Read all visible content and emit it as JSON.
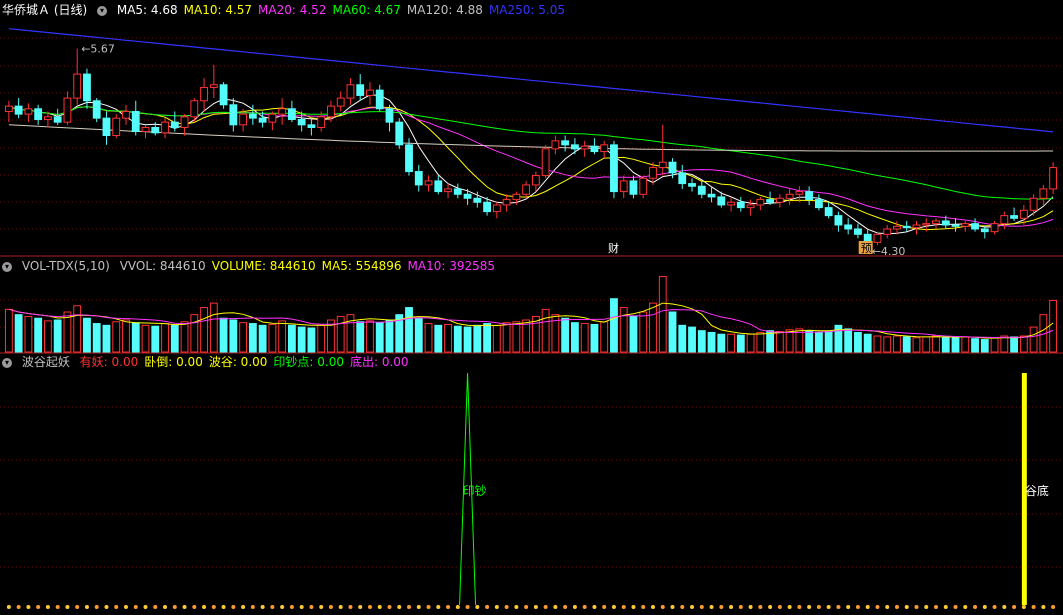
{
  "main": {
    "title": "华侨城Ａ (日线)",
    "ma": [
      {
        "label": "MA5: 4.68",
        "color": "#ffffff"
      },
      {
        "label": "MA10: 4.57",
        "color": "#ffff00"
      },
      {
        "label": "MA20: 4.52",
        "color": "#ff33ff"
      },
      {
        "label": "MA60: 4.67",
        "color": "#00ff00"
      },
      {
        "label": "MA120: 4.88",
        "color": "#c0c0c0"
      },
      {
        "label": "MA250: 5.05",
        "color": "#3333ff"
      }
    ],
    "high_label": "5.67",
    "low_label": "4.30",
    "event_caicai": "财",
    "event_yu": "预"
  },
  "volume": {
    "title": "VOL-TDX(5,10)",
    "items": [
      {
        "label": "VVOL: 844610",
        "color": "#c0c0c0"
      },
      {
        "label": "VOLUME: 844610",
        "color": "#ffff00"
      },
      {
        "label": "MA5: 554896",
        "color": "#ffff00"
      },
      {
        "label": "MA10: 392585",
        "color": "#ff33ff"
      }
    ]
  },
  "indicator": {
    "title": "波谷起妖",
    "items": [
      {
        "label": "有妖: 0.00",
        "color": "#ff3333"
      },
      {
        "label": "卧倒: 0.00",
        "color": "#ffff00"
      },
      {
        "label": "波谷: 0.00",
        "color": "#ffff00"
      },
      {
        "label": "印钞点: 0.00",
        "color": "#00ff00"
      },
      {
        "label": "底出: 0.00",
        "color": "#ff33ff"
      }
    ],
    "spike_label": "印钞",
    "bar_label": "谷底"
  },
  "chart_data": {
    "type": "candlestick",
    "up_color": "#ff3232",
    "down_color": "#54fcfc",
    "price_range": [
      4.2,
      5.9
    ],
    "ohlc": [
      [
        5.2,
        5.28,
        5.12,
        5.24
      ],
      [
        5.24,
        5.3,
        5.15,
        5.18
      ],
      [
        5.18,
        5.26,
        5.12,
        5.22
      ],
      [
        5.22,
        5.25,
        5.1,
        5.14
      ],
      [
        5.14,
        5.2,
        5.08,
        5.16
      ],
      [
        5.16,
        5.22,
        5.1,
        5.12
      ],
      [
        5.12,
        5.35,
        5.1,
        5.3
      ],
      [
        5.3,
        5.67,
        5.25,
        5.48
      ],
      [
        5.48,
        5.52,
        5.22,
        5.28
      ],
      [
        5.28,
        5.3,
        5.12,
        5.15
      ],
      [
        5.15,
        5.2,
        4.95,
        5.02
      ],
      [
        5.02,
        5.18,
        5.0,
        5.15
      ],
      [
        5.15,
        5.25,
        5.1,
        5.2
      ],
      [
        5.2,
        5.28,
        5.02,
        5.05
      ],
      [
        5.05,
        5.1,
        5.0,
        5.08
      ],
      [
        5.08,
        5.12,
        5.02,
        5.04
      ],
      [
        5.04,
        5.15,
        5.0,
        5.12
      ],
      [
        5.12,
        5.2,
        5.05,
        5.08
      ],
      [
        5.08,
        5.18,
        5.02,
        5.16
      ],
      [
        5.16,
        5.3,
        5.12,
        5.28
      ],
      [
        5.28,
        5.45,
        5.2,
        5.38
      ],
      [
        5.38,
        5.55,
        5.3,
        5.4
      ],
      [
        5.4,
        5.42,
        5.22,
        5.25
      ],
      [
        5.25,
        5.3,
        5.05,
        5.1
      ],
      [
        5.1,
        5.22,
        5.05,
        5.18
      ],
      [
        5.18,
        5.25,
        5.1,
        5.15
      ],
      [
        5.15,
        5.2,
        5.08,
        5.12
      ],
      [
        5.12,
        5.2,
        5.06,
        5.18
      ],
      [
        5.18,
        5.3,
        5.1,
        5.22
      ],
      [
        5.22,
        5.28,
        5.12,
        5.14
      ],
      [
        5.14,
        5.2,
        5.05,
        5.1
      ],
      [
        5.1,
        5.15,
        5.02,
        5.08
      ],
      [
        5.08,
        5.2,
        5.05,
        5.16
      ],
      [
        5.16,
        5.28,
        5.12,
        5.24
      ],
      [
        5.24,
        5.35,
        5.2,
        5.3
      ],
      [
        5.3,
        5.45,
        5.25,
        5.4
      ],
      [
        5.4,
        5.48,
        5.28,
        5.32
      ],
      [
        5.32,
        5.42,
        5.25,
        5.36
      ],
      [
        5.36,
        5.4,
        5.2,
        5.22
      ],
      [
        5.22,
        5.25,
        5.05,
        5.12
      ],
      [
        5.12,
        5.15,
        4.92,
        4.95
      ],
      [
        4.95,
        5.0,
        4.72,
        4.75
      ],
      [
        4.75,
        4.8,
        4.6,
        4.65
      ],
      [
        4.65,
        4.72,
        4.6,
        4.68
      ],
      [
        4.68,
        4.72,
        4.58,
        4.6
      ],
      [
        4.6,
        4.66,
        4.55,
        4.62
      ],
      [
        4.62,
        4.66,
        4.55,
        4.58
      ],
      [
        4.58,
        4.62,
        4.5,
        4.55
      ],
      [
        4.55,
        4.6,
        4.48,
        4.52
      ],
      [
        4.52,
        4.56,
        4.42,
        4.45
      ],
      [
        4.45,
        4.52,
        4.4,
        4.5
      ],
      [
        4.5,
        4.58,
        4.45,
        4.54
      ],
      [
        4.54,
        4.6,
        4.5,
        4.58
      ],
      [
        4.58,
        4.68,
        4.55,
        4.65
      ],
      [
        4.65,
        4.75,
        4.6,
        4.72
      ],
      [
        4.72,
        4.95,
        4.7,
        4.92
      ],
      [
        4.92,
        5.02,
        4.88,
        4.98
      ],
      [
        4.98,
        5.02,
        4.9,
        4.95
      ],
      [
        4.95,
        5.0,
        4.88,
        4.92
      ],
      [
        4.92,
        4.98,
        4.86,
        4.94
      ],
      [
        4.94,
        5.0,
        4.88,
        4.9
      ],
      [
        4.9,
        4.98,
        4.85,
        4.95
      ],
      [
        4.95,
        4.98,
        4.55,
        4.6
      ],
      [
        4.6,
        4.72,
        4.55,
        4.68
      ],
      [
        4.68,
        4.72,
        4.55,
        4.58
      ],
      [
        4.58,
        4.72,
        4.55,
        4.7
      ],
      [
        4.7,
        4.82,
        4.65,
        4.78
      ],
      [
        4.78,
        5.1,
        4.72,
        4.82
      ],
      [
        4.82,
        4.85,
        4.7,
        4.74
      ],
      [
        4.74,
        4.8,
        4.62,
        4.66
      ],
      [
        4.66,
        4.7,
        4.6,
        4.64
      ],
      [
        4.64,
        4.68,
        4.55,
        4.58
      ],
      [
        4.58,
        4.64,
        4.52,
        4.56
      ],
      [
        4.56,
        4.6,
        4.48,
        4.5
      ],
      [
        4.5,
        4.56,
        4.45,
        4.52
      ],
      [
        4.52,
        4.56,
        4.45,
        4.48
      ],
      [
        4.48,
        4.54,
        4.42,
        4.5
      ],
      [
        4.5,
        4.56,
        4.46,
        4.54
      ],
      [
        4.54,
        4.6,
        4.5,
        4.52
      ],
      [
        4.52,
        4.58,
        4.48,
        4.55
      ],
      [
        4.55,
        4.62,
        4.5,
        4.58
      ],
      [
        4.58,
        4.64,
        4.52,
        4.6
      ],
      [
        4.6,
        4.64,
        4.5,
        4.54
      ],
      [
        4.54,
        4.58,
        4.46,
        4.48
      ],
      [
        4.48,
        4.52,
        4.4,
        4.42
      ],
      [
        4.42,
        4.45,
        4.3,
        4.35
      ],
      [
        4.35,
        4.4,
        4.28,
        4.32
      ],
      [
        4.32,
        4.36,
        4.25,
        4.28
      ],
      [
        4.28,
        4.32,
        4.2,
        4.22
      ],
      [
        4.22,
        4.3,
        4.2,
        4.28
      ],
      [
        4.28,
        4.35,
        4.25,
        4.32
      ],
      [
        4.32,
        4.38,
        4.28,
        4.34
      ],
      [
        4.34,
        4.38,
        4.3,
        4.33
      ],
      [
        4.33,
        4.38,
        4.28,
        4.35
      ],
      [
        4.35,
        4.4,
        4.3,
        4.36
      ],
      [
        4.36,
        4.4,
        4.32,
        4.38
      ],
      [
        4.38,
        4.42,
        4.32,
        4.35
      ],
      [
        4.35,
        4.4,
        4.3,
        4.34
      ],
      [
        4.34,
        4.38,
        4.3,
        4.36
      ],
      [
        4.36,
        4.4,
        4.3,
        4.32
      ],
      [
        4.32,
        4.34,
        4.25,
        4.3
      ],
      [
        4.3,
        4.38,
        4.28,
        4.36
      ],
      [
        4.36,
        4.45,
        4.32,
        4.42
      ],
      [
        4.42,
        4.48,
        4.38,
        4.4
      ],
      [
        4.4,
        4.5,
        4.35,
        4.46
      ],
      [
        4.46,
        4.58,
        4.42,
        4.55
      ],
      [
        4.55,
        4.65,
        4.5,
        4.62
      ],
      [
        4.62,
        4.82,
        4.58,
        4.78
      ]
    ],
    "volume": [
      0.48,
      0.42,
      0.4,
      0.38,
      0.35,
      0.36,
      0.45,
      0.52,
      0.38,
      0.32,
      0.3,
      0.34,
      0.36,
      0.33,
      0.3,
      0.29,
      0.32,
      0.3,
      0.34,
      0.42,
      0.5,
      0.55,
      0.38,
      0.36,
      0.33,
      0.32,
      0.3,
      0.31,
      0.35,
      0.3,
      0.28,
      0.27,
      0.3,
      0.36,
      0.4,
      0.42,
      0.34,
      0.35,
      0.33,
      0.36,
      0.42,
      0.5,
      0.38,
      0.32,
      0.3,
      0.31,
      0.29,
      0.28,
      0.3,
      0.32,
      0.3,
      0.33,
      0.34,
      0.36,
      0.4,
      0.48,
      0.42,
      0.38,
      0.33,
      0.32,
      0.31,
      0.34,
      0.6,
      0.5,
      0.4,
      0.45,
      0.55,
      0.85,
      0.45,
      0.3,
      0.28,
      0.24,
      0.22,
      0.2,
      0.2,
      0.19,
      0.2,
      0.22,
      0.24,
      0.23,
      0.25,
      0.26,
      0.24,
      0.22,
      0.23,
      0.3,
      0.26,
      0.22,
      0.2,
      0.18,
      0.17,
      0.18,
      0.17,
      0.16,
      0.17,
      0.18,
      0.17,
      0.16,
      0.17,
      0.15,
      0.14,
      0.16,
      0.18,
      0.17,
      0.18,
      0.28,
      0.42,
      0.58
    ],
    "indicator": {
      "spike_index": 47,
      "bar_index": 104
    }
  }
}
